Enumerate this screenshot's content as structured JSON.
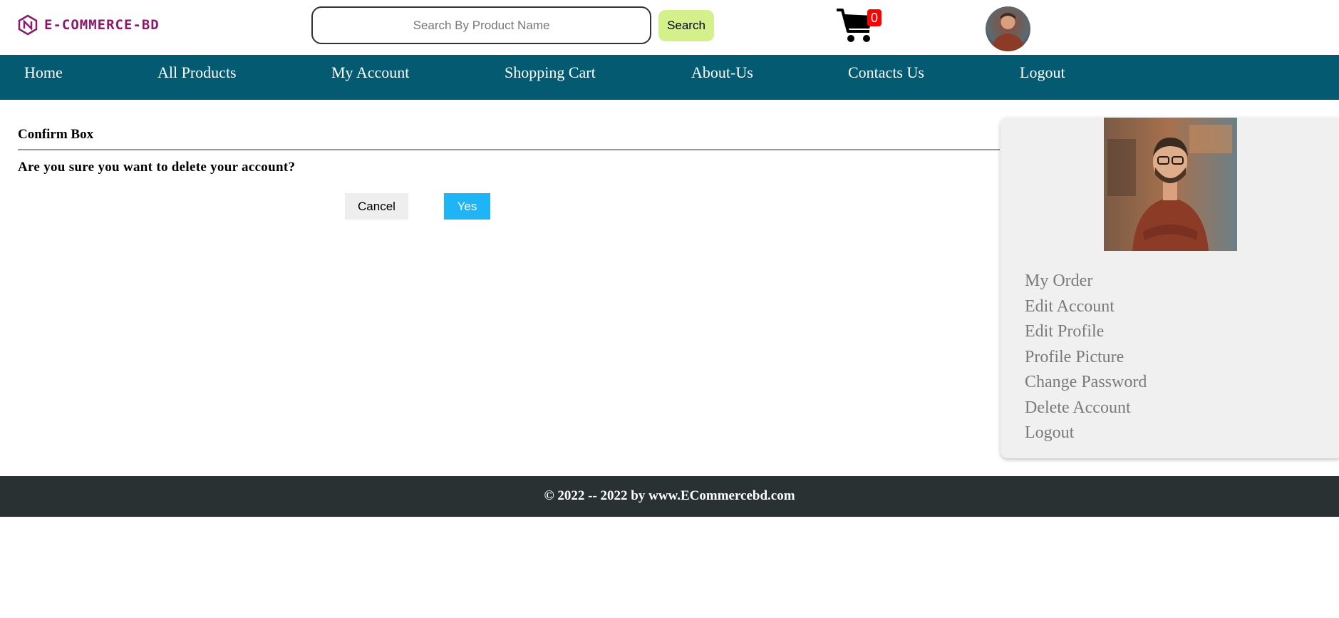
{
  "header": {
    "logo_text": "E-COMMERCE-BD",
    "search": {
      "placeholder": "Search By Product Name",
      "value": "",
      "button_label": "Search"
    },
    "cart": {
      "count": "0"
    }
  },
  "nav": {
    "items": [
      {
        "label": "Home"
      },
      {
        "label": "All Products"
      },
      {
        "label": "My Account"
      },
      {
        "label": "Shopping Cart"
      },
      {
        "label": "About-Us"
      },
      {
        "label": "Contacts Us"
      },
      {
        "label": "Logout"
      }
    ]
  },
  "confirm": {
    "title": "Confirm Box",
    "question": "Are you sure you want to delete your account?",
    "cancel_label": "Cancel",
    "yes_label": "Yes"
  },
  "sidebar": {
    "menu": [
      {
        "label": "My Order"
      },
      {
        "label": "Edit Account"
      },
      {
        "label": "Edit Profile"
      },
      {
        "label": "Profile Picture"
      },
      {
        "label": "Change Password"
      },
      {
        "label": "Delete Account"
      },
      {
        "label": "Logout"
      }
    ]
  },
  "footer": {
    "text": "© 2022 -- 2022 by www.ECommercebd.com"
  },
  "colors": {
    "nav_bg": "#045a70",
    "footer_bg": "#293132",
    "search_button_bg": "#d4f08a",
    "yes_button_bg": "#1eb4f5",
    "cart_badge_bg": "#ff0000",
    "logo_color": "#8b1a6b"
  }
}
